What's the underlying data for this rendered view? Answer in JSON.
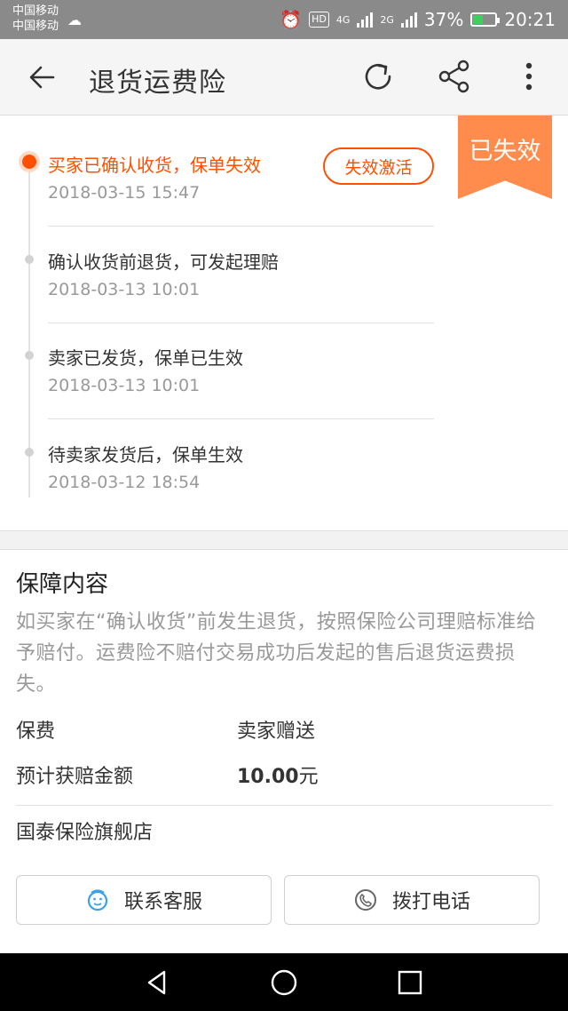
{
  "status_bar": {
    "carrier_1": "中国移动",
    "carrier_2": "中国移动",
    "network_4g": "4G",
    "network_2g": "2G",
    "hd": "HD",
    "battery": "37%",
    "time": "20:21"
  },
  "header": {
    "title": "退货运费险",
    "icons": [
      "back-arrow-icon",
      "refresh-icon",
      "share-icon",
      "more-icon"
    ]
  },
  "timeline": {
    "expired_badge": "已失效",
    "reactivate_label": "失效激活",
    "events": [
      {
        "title": "买家已确认收货，保单失效",
        "time": "2018-03-15 15:47",
        "active": true
      },
      {
        "title": "确认收货前退货，可发起理赔",
        "time": "2018-03-13 10:01",
        "active": false
      },
      {
        "title": "卖家已发货，保单已生效",
        "time": "2018-03-13 10:01",
        "active": false
      },
      {
        "title": "待卖家发货后，保单生效",
        "time": "2018-03-12 18:54",
        "active": false
      }
    ]
  },
  "coverage": {
    "title": "保障内容",
    "description": "如买家在“确认收货”前发生退货，按照保险公司理赔标准给予赔付。运费险不赔付交易成功后发起的售后退货运费损失。",
    "premium_label": "保费",
    "premium_value": "卖家赠送",
    "payout_label": "预计获赔金额",
    "payout_amount": "10.00",
    "payout_unit": "元",
    "shop_name": "国泰保险旗舰店",
    "contact_service_label": "联系客服",
    "call_label": "拨打电话"
  },
  "colors": {
    "accent": "#ff5000",
    "badge": "#ff8c4d",
    "muted": "#999999"
  }
}
